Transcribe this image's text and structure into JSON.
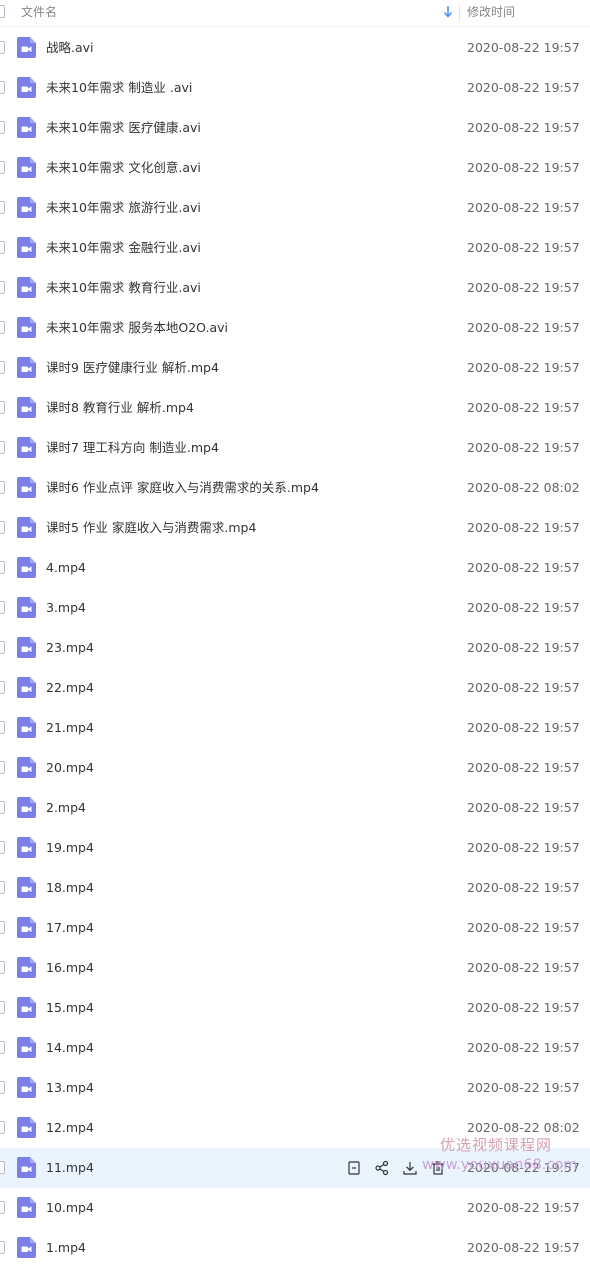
{
  "header": {
    "name_label": "文件名",
    "time_label": "修改时间"
  },
  "files": [
    {
      "name": "战略.avi",
      "date": "2020-08-22 19:57"
    },
    {
      "name": "未来10年需求 制造业 .avi",
      "date": "2020-08-22 19:57"
    },
    {
      "name": "未来10年需求 医疗健康.avi",
      "date": "2020-08-22 19:57"
    },
    {
      "name": "未来10年需求 文化创意.avi",
      "date": "2020-08-22 19:57"
    },
    {
      "name": "未来10年需求 旅游行业.avi",
      "date": "2020-08-22 19:57"
    },
    {
      "name": "未来10年需求 金融行业.avi",
      "date": "2020-08-22 19:57"
    },
    {
      "name": "未来10年需求 教育行业.avi",
      "date": "2020-08-22 19:57"
    },
    {
      "name": "未来10年需求 服务本地O2O.avi",
      "date": "2020-08-22 19:57"
    },
    {
      "name": "课时9 医疗健康行业 解析.mp4",
      "date": "2020-08-22 19:57"
    },
    {
      "name": "课时8 教育行业 解析.mp4",
      "date": "2020-08-22 19:57"
    },
    {
      "name": "课时7 理工科方向 制造业.mp4",
      "date": "2020-08-22 19:57"
    },
    {
      "name": "课时6 作业点评 家庭收入与消费需求的关系.mp4",
      "date": "2020-08-22 08:02"
    },
    {
      "name": "课时5 作业 家庭收入与消费需求.mp4",
      "date": "2020-08-22 19:57"
    },
    {
      "name": "4.mp4",
      "date": "2020-08-22 19:57"
    },
    {
      "name": "3.mp4",
      "date": "2020-08-22 19:57"
    },
    {
      "name": "23.mp4",
      "date": "2020-08-22 19:57"
    },
    {
      "name": "22.mp4",
      "date": "2020-08-22 19:57"
    },
    {
      "name": "21.mp4",
      "date": "2020-08-22 19:57"
    },
    {
      "name": "20.mp4",
      "date": "2020-08-22 19:57"
    },
    {
      "name": "2.mp4",
      "date": "2020-08-22 19:57"
    },
    {
      "name": "19.mp4",
      "date": "2020-08-22 19:57"
    },
    {
      "name": "18.mp4",
      "date": "2020-08-22 19:57"
    },
    {
      "name": "17.mp4",
      "date": "2020-08-22 19:57"
    },
    {
      "name": "16.mp4",
      "date": "2020-08-22 19:57"
    },
    {
      "name": "15.mp4",
      "date": "2020-08-22 19:57"
    },
    {
      "name": "14.mp4",
      "date": "2020-08-22 19:57"
    },
    {
      "name": "13.mp4",
      "date": "2020-08-22 19:57"
    },
    {
      "name": "12.mp4",
      "date": "2020-08-22 08:02"
    },
    {
      "name": "11.mp4",
      "date": "2020-08-22 19:57",
      "hovered": true
    },
    {
      "name": "10.mp4",
      "date": "2020-08-22 19:57"
    },
    {
      "name": "1.mp4",
      "date": "2020-08-22 19:57"
    }
  ],
  "row_actions": [
    "file-icon",
    "share-icon",
    "download-icon",
    "delete-icon"
  ],
  "watermark": {
    "line1": "优选视频课程网",
    "line2": "www.youxuan68.com"
  },
  "colors": {
    "file_icon": "#7b7fe8",
    "hover_row": "#eaf4ff",
    "sort_arrow": "#4a8cf0"
  }
}
